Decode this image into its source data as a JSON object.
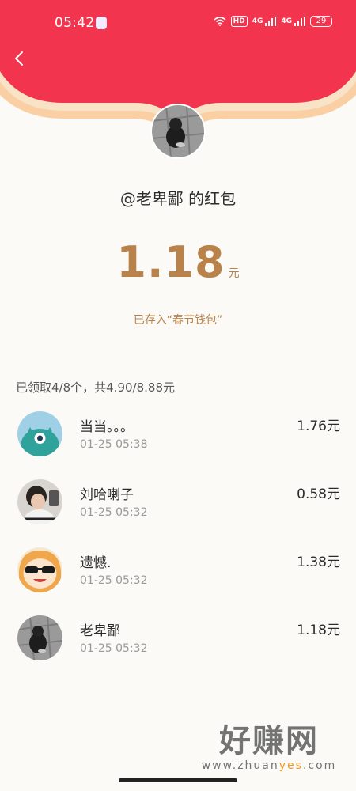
{
  "status_bar": {
    "time": "05:42",
    "hd": "HD",
    "net1": "4G",
    "net2": "4G",
    "battery": "29"
  },
  "packet": {
    "title": "@老卑鄙 的红包",
    "amount": "1.18",
    "unit": "元",
    "wallet_note": "已存入“春节钱包”"
  },
  "summary": "已领取4/8个，共4.90/8.88元",
  "records": [
    {
      "name": "当当。。。",
      "time": "01-25 05:38",
      "amount": "1.76元"
    },
    {
      "name": "刘哈喇子",
      "time": "01-25 05:32",
      "amount": "0.58元"
    },
    {
      "name": "遗憾.",
      "time": "01-25 05:32",
      "amount": "1.38元"
    },
    {
      "name": "老卑鄙",
      "time": "01-25 05:32",
      "amount": "1.18元"
    }
  ],
  "watermark": {
    "main": "好赚网",
    "url_pre": "www.zhuan",
    "url_accent": "yes",
    "url_post": ".com"
  },
  "colors": {
    "header_red": "#f2344e",
    "header_trim": "#f9cfa3",
    "gold": "#b8824a"
  }
}
